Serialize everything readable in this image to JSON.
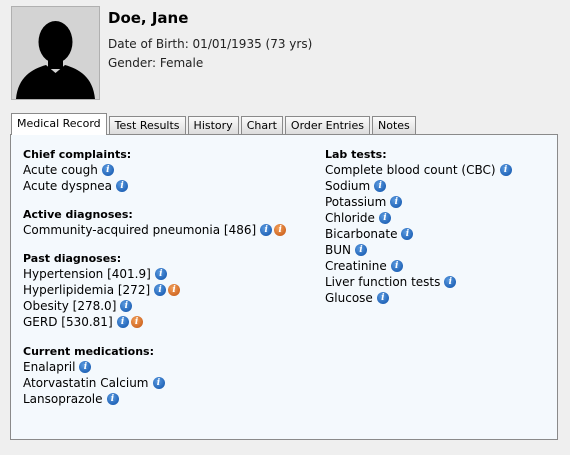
{
  "patient": {
    "name": "Doe, Jane",
    "dob": "Date of Birth: 01/01/1935 (73 yrs)",
    "gender": "Gender: Female"
  },
  "tabs": [
    {
      "label": "Medical Record",
      "active": true
    },
    {
      "label": "Test Results"
    },
    {
      "label": "History"
    },
    {
      "label": "Chart"
    },
    {
      "label": "Order Entries"
    },
    {
      "label": "Notes"
    }
  ],
  "left": {
    "chief_complaints": {
      "heading": "Chief complaints:",
      "items": [
        "Acute cough",
        "Acute dyspnea"
      ]
    },
    "active_diagnoses": {
      "heading": "Active diagnoses:",
      "items": [
        "Community-acquired pneumonia [486]"
      ]
    },
    "past_diagnoses": {
      "heading": "Past diagnoses:",
      "items": [
        "Hypertension [401.9]",
        "Hyperlipidemia [272]",
        "Obesity [278.0]",
        "GERD [530.81]"
      ]
    },
    "current_medications": {
      "heading": "Current medications:",
      "items": [
        "Enalapril",
        "Atorvastatin Calcium",
        "Lansoprazole"
      ]
    }
  },
  "right": {
    "lab_tests": {
      "heading": "Lab tests:",
      "items": [
        "Complete blood count (CBC)",
        "Sodium",
        "Potassium",
        "Chloride",
        "Bicarbonate",
        "BUN",
        "Creatinine",
        "Liver function tests",
        "Glucose"
      ]
    }
  },
  "icons": {
    "info_glyph": "i",
    "info_blue_color": "#1a5fb4",
    "info_orange_color": "#d9651a"
  }
}
